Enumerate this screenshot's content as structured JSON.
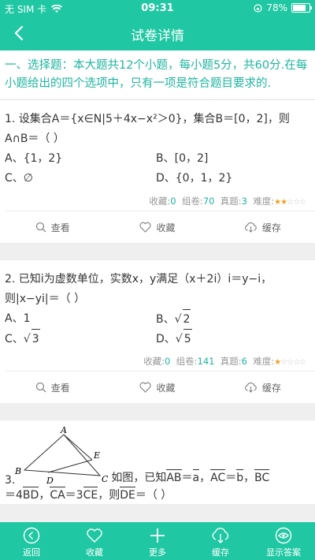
{
  "status": {
    "carrier": "无 SIM 卡",
    "time": "09:31",
    "battery": "78%",
    "battery_level": 0.78
  },
  "nav": {
    "title": "试卷详情"
  },
  "intro": "一、选择题：本大题共12个小题，每小题5分，共60分.在每小题给出的四个选项中，只有一项是符合题目要求的.",
  "q1": {
    "text": "1.  设集合A＝{x∈N|5＋4x−x²＞0}，集合B＝[0，2]，则A∩B＝（      ）",
    "options": [
      "A、{1，2}",
      "B、[0，2]",
      "C、∅",
      "D、{0，1，2}"
    ],
    "collect_label": "收藏:",
    "collect_count": "0",
    "group_label": "组卷:",
    "group_count": "70",
    "real_label": "真题:",
    "real_count": "3",
    "difficulty_label": "难度:",
    "difficulty": 2
  },
  "q2": {
    "text": "2.  已知i为虚数单位，实数x，y满足（x＋2i）i＝y−i，则|x−yi|＝（      ）",
    "opt_a": "A、1",
    "opt_b_prefix": "B、",
    "opt_b_rad": "2",
    "opt_c_prefix": "C、",
    "opt_c_rad": "3",
    "opt_d_prefix": "D、",
    "opt_d_rad": "5",
    "collect_label": "收藏:",
    "collect_count": "0",
    "group_label": "组卷:",
    "group_count": "141",
    "real_label": "真题:",
    "real_count": "6",
    "difficulty_label": "难度:",
    "difficulty": 1
  },
  "q3": {
    "figure": {
      "a": "A",
      "b": "B",
      "c": "C",
      "d": "D",
      "e": "E"
    },
    "num": "3.",
    "text_pre": "如图，已知",
    "ab": "AB",
    "eq1": "＝",
    "a_vec": "a",
    "comma1": "，",
    "ac": "AC",
    "eq2": "＝",
    "b_vec": "b",
    "comma2": "，",
    "bc": "BC",
    "line2_pre": "＝4",
    "bd": "BD",
    "comma3": "，",
    "ca": "CA",
    "eq3": "＝3",
    "ce": "CE",
    "then": "，则",
    "de": "DE",
    "line2_post": "＝（      ）"
  },
  "actions": {
    "view": "查看",
    "collect": "收藏",
    "cache": "缓存"
  },
  "tabs": {
    "back": "返回",
    "collect": "收藏",
    "more": "更多",
    "cache": "缓存",
    "answer": "显示答案"
  }
}
